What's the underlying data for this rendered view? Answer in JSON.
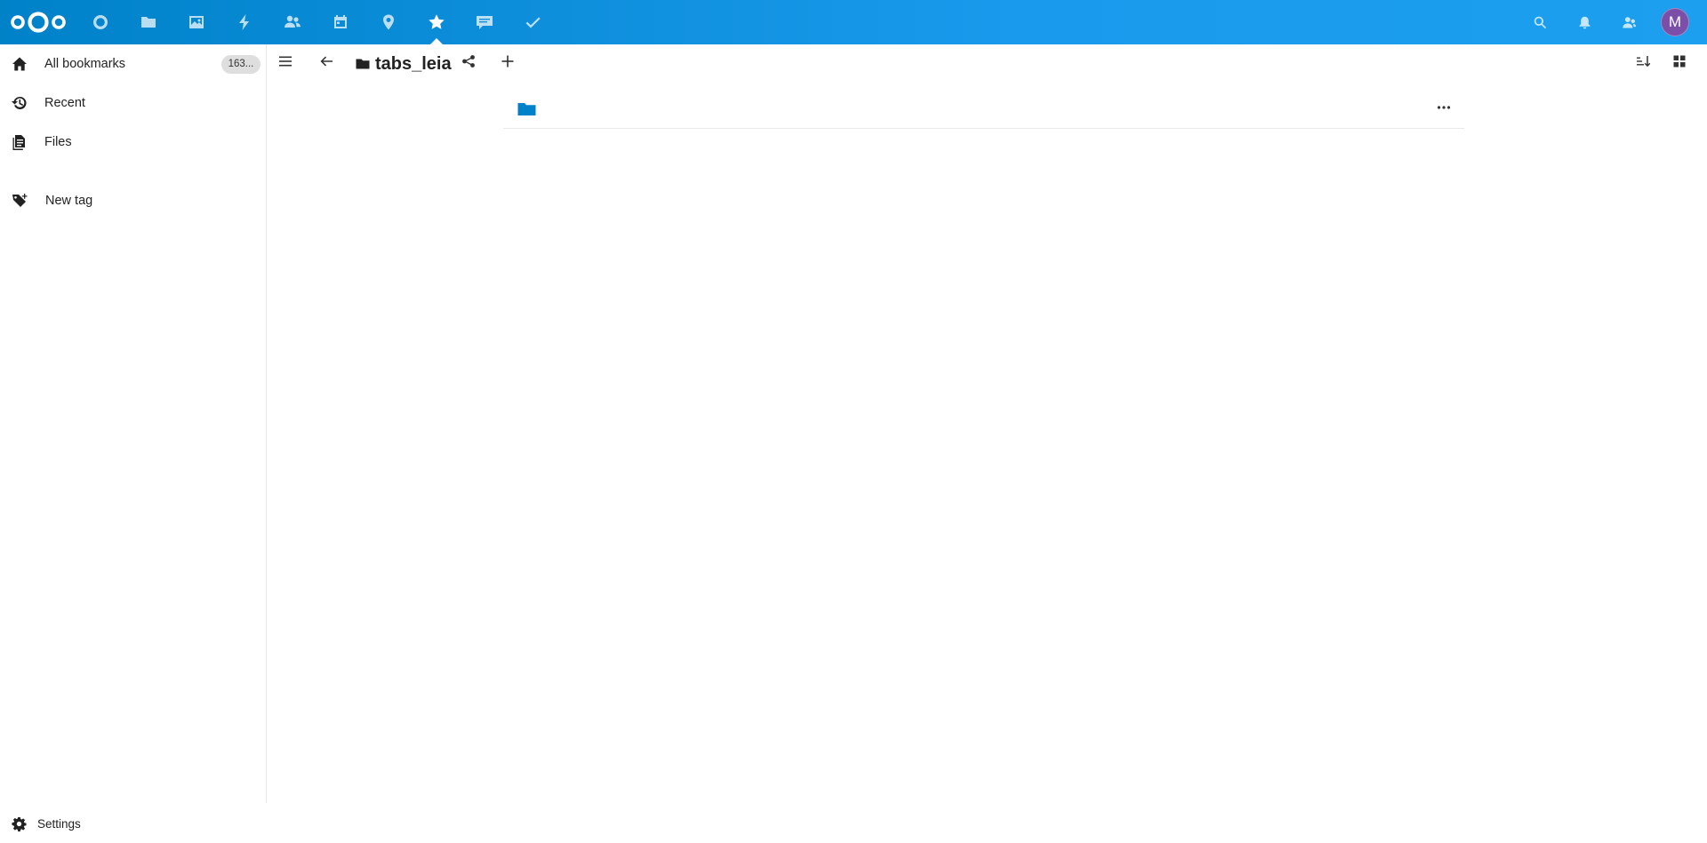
{
  "header": {
    "apps": [
      {
        "name": "dashboard-app-icon",
        "icon": "circle-icon"
      },
      {
        "name": "files-app-icon",
        "icon": "folder-icon"
      },
      {
        "name": "photos-app-icon",
        "icon": "image-icon"
      },
      {
        "name": "activity-app-icon",
        "icon": "lightning-icon"
      },
      {
        "name": "contacts-app-icon",
        "icon": "contacts-icon"
      },
      {
        "name": "calendar-app-icon",
        "icon": "calendar-icon"
      },
      {
        "name": "maps-app-icon",
        "icon": "map-pin-icon"
      },
      {
        "name": "bookmarks-app-icon",
        "icon": "star-icon",
        "active": true
      },
      {
        "name": "talk-app-icon",
        "icon": "chat-icon"
      },
      {
        "name": "tasks-app-icon",
        "icon": "check-icon"
      }
    ],
    "avatar_initial": "M",
    "brand_color": "#0082c9",
    "avatar_color": "#7b4fa8"
  },
  "sidebar": {
    "items": [
      {
        "label": "All bookmarks",
        "count": "163...",
        "icon": "home-icon"
      },
      {
        "label": "Recent",
        "icon": "history-icon"
      },
      {
        "label": "Files",
        "icon": "file-icon"
      },
      {
        "label": "New tag",
        "icon": "tag-plus-icon"
      }
    ],
    "settings_label": "Settings"
  },
  "toolbar": {
    "folder_name": "tabs_leia"
  },
  "bookmarks": [
    {
      "type": "folder",
      "title": ""
    }
  ]
}
